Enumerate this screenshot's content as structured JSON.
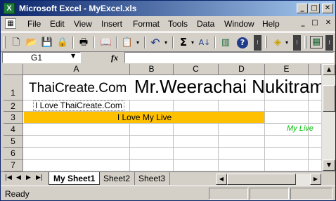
{
  "window": {
    "title": "Microsoft Excel - MyExcel.xls",
    "app_icon": "excel-icon",
    "controls": {
      "minimize": "_",
      "maximize": "□",
      "close": "✕"
    }
  },
  "menu": {
    "items": [
      "File",
      "Edit",
      "View",
      "Insert",
      "Format",
      "Tools",
      "Data",
      "Window",
      "Help"
    ]
  },
  "toolbar": {
    "icons": [
      "new-icon",
      "open-icon",
      "save-icon",
      "permission-icon",
      "print-icon",
      "research-icon",
      "paste-icon",
      "undo-icon",
      "autosum-icon",
      "sort-ascending-icon",
      "chart-icon",
      "help-icon",
      "fill-color-icon",
      "options-icon"
    ],
    "glyphs": {
      "new": "🗋",
      "open": "📂",
      "save": "💾",
      "permission": "🔒",
      "print": "🖶",
      "research": "📖",
      "paste": "📋",
      "undo": "↶",
      "autosum": "Σ",
      "sort": "A↓",
      "chart": "▥",
      "help": "?",
      "fill": "◈",
      "options": "⁞"
    }
  },
  "formula_bar": {
    "name_box": "G1",
    "fx_label": "fx",
    "formula": ""
  },
  "grid": {
    "columns": [
      "A",
      "B",
      "C",
      "D",
      "E"
    ],
    "rows": [
      "1",
      "2",
      "3",
      "4",
      "5",
      "6",
      "7"
    ],
    "cells": {
      "A1": "ThaiCreate.Com",
      "B1": "Mr.Weerachai Nukitram",
      "A2": "I Love ThaiCreate.Com",
      "A3_merged": "I Love My Live",
      "E4": "My Live"
    },
    "colors": {
      "merged_fill": "#ffc000",
      "e4_text": "#00c000",
      "grid_line": "#c0c0c0"
    }
  },
  "sheets": {
    "nav": [
      "|◀",
      "◀",
      "▶",
      "▶|"
    ],
    "tabs": [
      "My Sheet1",
      "Sheet2",
      "Sheet3"
    ],
    "active": "My Sheet1"
  },
  "status": {
    "text": "Ready"
  }
}
